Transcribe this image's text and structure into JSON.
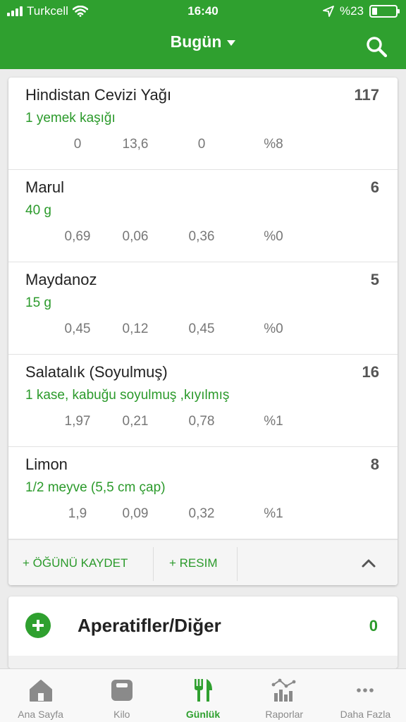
{
  "status": {
    "carrier": "Turkcell",
    "time": "16:40",
    "battery": "%23"
  },
  "header": {
    "title": "Bugün"
  },
  "foods": [
    {
      "name": "Hindistan Cevizi Yağı",
      "amount": "1 yemek kaşığı",
      "calories": "117",
      "nutrients": [
        "0",
        "13,6",
        "0",
        "%8"
      ]
    },
    {
      "name": "Marul",
      "amount": "40 g",
      "calories": "6",
      "nutrients": [
        "0,69",
        "0,06",
        "0,36",
        "%0"
      ]
    },
    {
      "name": "Maydanoz",
      "amount": "15 g",
      "calories": "5",
      "nutrients": [
        "0,45",
        "0,12",
        "0,45",
        "%0"
      ]
    },
    {
      "name": "Salatalık (Soyulmuş)",
      "amount": "1 kase, kabuğu soyulmuş ,kıyılmış",
      "calories": "16",
      "nutrients": [
        "1,97",
        "0,21",
        "0,78",
        "%1"
      ]
    },
    {
      "name": "Limon",
      "amount": "1/2 meyve (5,5 cm çap)",
      "calories": "8",
      "nutrients": [
        "1,9",
        "0,09",
        "0,32",
        "%1"
      ]
    }
  ],
  "actions": {
    "save": "+ ÖĞÜNÜ KAYDET",
    "photo": "+ RESIM"
  },
  "snacks": {
    "title": "Aperatifler/Diğer",
    "count": "0"
  },
  "nav": [
    {
      "label": "Ana Sayfa",
      "icon": "home-icon"
    },
    {
      "label": "Kilo",
      "icon": "scale-icon"
    },
    {
      "label": "Günlük",
      "icon": "fork-knife-icon"
    },
    {
      "label": "Raporlar",
      "icon": "chart-icon"
    },
    {
      "label": "Daha Fazla",
      "icon": "more-icon"
    }
  ],
  "colors": {
    "brand": "#2fa02f",
    "accent_text": "#2b9a2b"
  }
}
